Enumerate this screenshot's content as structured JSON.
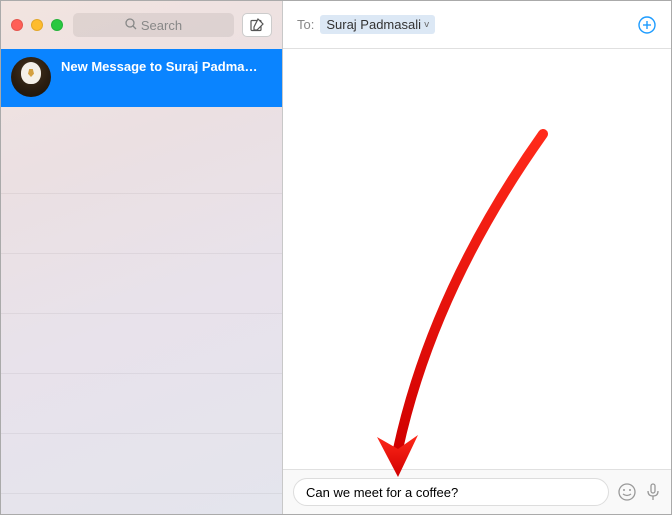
{
  "search": {
    "placeholder": "Search"
  },
  "conversation": {
    "title": "New Message to Suraj Padma…"
  },
  "toBar": {
    "label": "To:",
    "recipient": "Suraj Padmasali"
  },
  "composer": {
    "value": "Can we meet for a coffee?"
  }
}
